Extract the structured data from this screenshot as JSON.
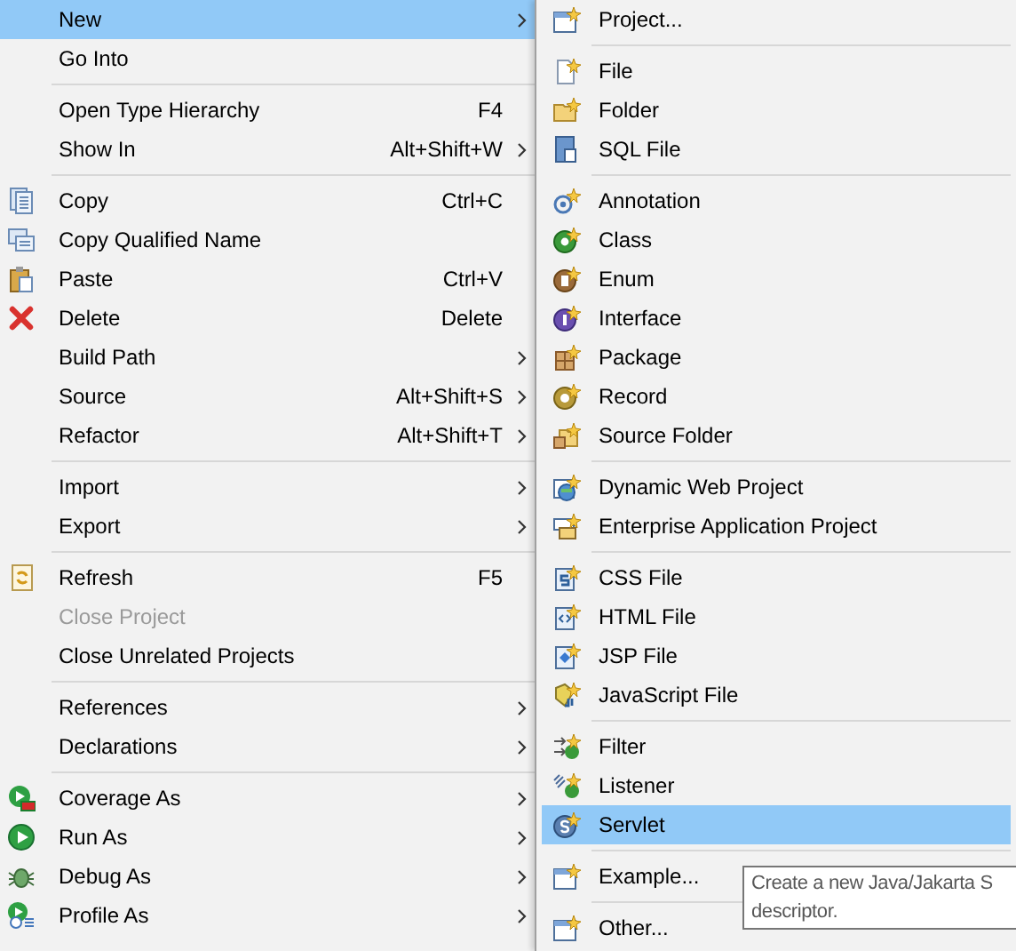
{
  "context_menu": {
    "items": [
      {
        "kind": "item",
        "label": "New",
        "has_submenu": true,
        "selected": true,
        "disabled": false
      },
      {
        "kind": "item",
        "label": "Go Into",
        "has_submenu": false,
        "selected": false,
        "disabled": false
      },
      {
        "kind": "separator"
      },
      {
        "kind": "item",
        "label": "Open Type Hierarchy",
        "shortcut": "F4",
        "has_submenu": false,
        "selected": false,
        "disabled": false
      },
      {
        "kind": "item",
        "label": "Show In",
        "shortcut": "Alt+Shift+W",
        "has_submenu": true,
        "selected": false,
        "disabled": false
      },
      {
        "kind": "separator"
      },
      {
        "kind": "item",
        "label": "Copy",
        "shortcut": "Ctrl+C",
        "has_submenu": false,
        "selected": false,
        "disabled": false
      },
      {
        "kind": "item",
        "label": "Copy Qualified Name",
        "has_submenu": false,
        "selected": false,
        "disabled": false
      },
      {
        "kind": "item",
        "label": "Paste",
        "shortcut": "Ctrl+V",
        "has_submenu": false,
        "selected": false,
        "disabled": false
      },
      {
        "kind": "item",
        "label": "Delete",
        "shortcut": "Delete",
        "has_submenu": false,
        "selected": false,
        "disabled": false
      },
      {
        "kind": "item",
        "label": "Build Path",
        "has_submenu": true,
        "selected": false,
        "disabled": false
      },
      {
        "kind": "item",
        "label": "Source",
        "shortcut": "Alt+Shift+S",
        "has_submenu": true,
        "selected": false,
        "disabled": false
      },
      {
        "kind": "item",
        "label": "Refactor",
        "shortcut": "Alt+Shift+T",
        "has_submenu": true,
        "selected": false,
        "disabled": false
      },
      {
        "kind": "separator"
      },
      {
        "kind": "item",
        "label": "Import",
        "has_submenu": true,
        "selected": false,
        "disabled": false
      },
      {
        "kind": "item",
        "label": "Export",
        "has_submenu": true,
        "selected": false,
        "disabled": false
      },
      {
        "kind": "separator"
      },
      {
        "kind": "item",
        "label": "Refresh",
        "shortcut": "F5",
        "has_submenu": false,
        "selected": false,
        "disabled": false
      },
      {
        "kind": "item",
        "label": "Close Project",
        "has_submenu": false,
        "selected": false,
        "disabled": true
      },
      {
        "kind": "item",
        "label": "Close Unrelated Projects",
        "has_submenu": false,
        "selected": false,
        "disabled": false
      },
      {
        "kind": "separator"
      },
      {
        "kind": "item",
        "label": "References",
        "has_submenu": true,
        "selected": false,
        "disabled": false
      },
      {
        "kind": "item",
        "label": "Declarations",
        "has_submenu": true,
        "selected": false,
        "disabled": false
      },
      {
        "kind": "separator"
      },
      {
        "kind": "item",
        "label": "Coverage As",
        "has_submenu": true,
        "selected": false,
        "disabled": false
      },
      {
        "kind": "item",
        "label": "Run As",
        "has_submenu": true,
        "selected": false,
        "disabled": false
      },
      {
        "kind": "item",
        "label": "Debug As",
        "has_submenu": true,
        "selected": false,
        "disabled": false
      },
      {
        "kind": "item",
        "label": "Profile As",
        "has_submenu": true,
        "selected": false,
        "disabled": false
      }
    ]
  },
  "new_submenu": {
    "items": [
      {
        "kind": "item",
        "label": "Project...",
        "selected": false
      },
      {
        "kind": "separator"
      },
      {
        "kind": "item",
        "label": "File",
        "selected": false
      },
      {
        "kind": "item",
        "label": "Folder",
        "selected": false
      },
      {
        "kind": "item",
        "label": "SQL File",
        "selected": false
      },
      {
        "kind": "separator"
      },
      {
        "kind": "item",
        "label": "Annotation",
        "selected": false
      },
      {
        "kind": "item",
        "label": "Class",
        "selected": false
      },
      {
        "kind": "item",
        "label": "Enum",
        "selected": false
      },
      {
        "kind": "item",
        "label": "Interface",
        "selected": false
      },
      {
        "kind": "item",
        "label": "Package",
        "selected": false
      },
      {
        "kind": "item",
        "label": "Record",
        "selected": false
      },
      {
        "kind": "item",
        "label": "Source Folder",
        "selected": false
      },
      {
        "kind": "separator"
      },
      {
        "kind": "item",
        "label": "Dynamic Web Project",
        "selected": false
      },
      {
        "kind": "item",
        "label": "Enterprise Application Project",
        "selected": false
      },
      {
        "kind": "separator"
      },
      {
        "kind": "item",
        "label": "CSS File",
        "selected": false
      },
      {
        "kind": "item",
        "label": "HTML File",
        "selected": false
      },
      {
        "kind": "item",
        "label": "JSP File",
        "selected": false
      },
      {
        "kind": "item",
        "label": "JavaScript File",
        "selected": false
      },
      {
        "kind": "separator"
      },
      {
        "kind": "item",
        "label": "Filter",
        "selected": false
      },
      {
        "kind": "item",
        "label": "Listener",
        "selected": false
      },
      {
        "kind": "item",
        "label": "Servlet",
        "selected": true
      },
      {
        "kind": "separator"
      },
      {
        "kind": "item",
        "label": "Example...",
        "selected": false
      },
      {
        "kind": "separator"
      },
      {
        "kind": "item",
        "label": "Other...",
        "selected": false
      }
    ]
  },
  "tooltip": {
    "lines": [
      "Create a new Java/Jakarta S",
      "descriptor."
    ]
  }
}
